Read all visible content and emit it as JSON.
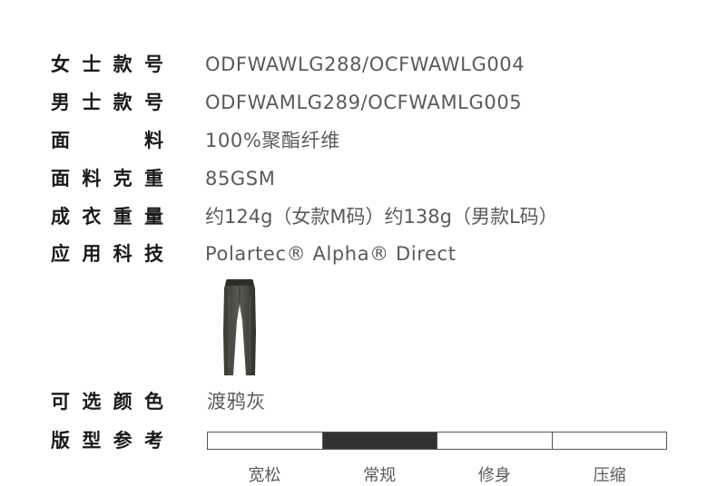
{
  "specs": [
    {
      "label": [
        "女",
        "士",
        "款",
        "号"
      ],
      "value": "ODFWAWLG288/OCFWAWLG004"
    },
    {
      "label": [
        "男",
        "士",
        "款",
        "号"
      ],
      "value": "ODFWAMLG289/OCFWAMLG005"
    },
    {
      "label": [
        "面",
        "料"
      ],
      "value": "100%聚酯纤维"
    },
    {
      "label": [
        "面",
        "料",
        "克",
        "重"
      ],
      "value": "85GSM"
    },
    {
      "label": [
        "成",
        "衣",
        "重",
        "量"
      ],
      "value": "约124g（女款M码）约138g（男款L码）"
    },
    {
      "label": [
        "应",
        "用",
        "科",
        "技"
      ],
      "value": "Polartec® Alpha® Direct"
    }
  ],
  "colors": {
    "label": [
      "可",
      "选",
      "颜",
      "色"
    ],
    "value": "渡鸦灰",
    "swatch": "#4a4a42"
  },
  "fit": {
    "label": [
      "版",
      "型",
      "参",
      "考"
    ],
    "options": [
      "宽松",
      "常规",
      "修身",
      "压缩"
    ],
    "selected": 1,
    "active_color": "#333333"
  }
}
